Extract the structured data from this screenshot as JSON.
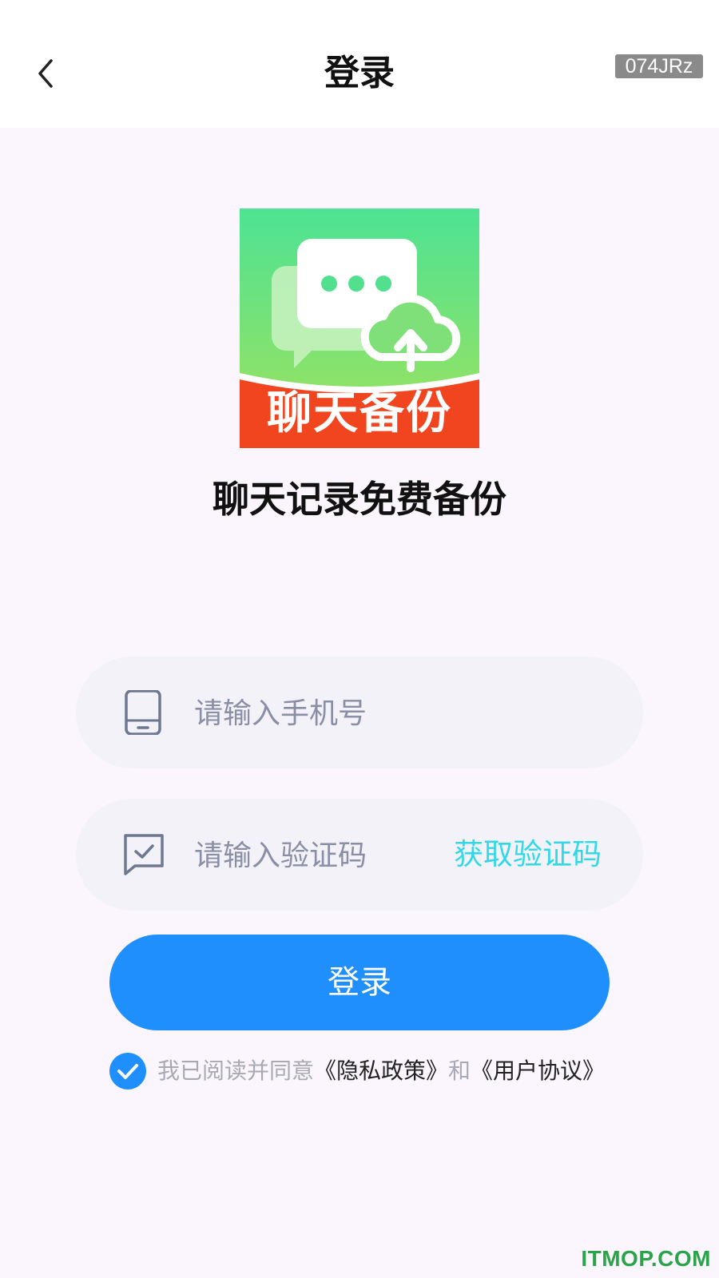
{
  "header": {
    "title": "登录",
    "build_tag": "074JRz"
  },
  "logo": {
    "label": "聊天备份",
    "colors": {
      "gradient_top": "#4de394",
      "gradient_bottom": "#a3e15a",
      "banner": "#f1451f"
    }
  },
  "tagline": "聊天记录免费备份",
  "form": {
    "phone": {
      "placeholder": "请输入手机号",
      "value": ""
    },
    "code": {
      "placeholder": "请输入验证码",
      "value": "",
      "get_code_label": "获取验证码"
    },
    "login_label": "登录"
  },
  "agreement": {
    "checked": true,
    "prefix": "我已阅读并同意",
    "privacy_link": "《隐私政策》",
    "conjunction": "和",
    "terms_link": "《用户协议》"
  },
  "watermark": "ITMOP.COM",
  "colors": {
    "primary": "#1f8ffd",
    "accent_cyan": "#33d8e6",
    "page_bg": "#fbf6fd",
    "field_bg": "#f3f2f8"
  }
}
